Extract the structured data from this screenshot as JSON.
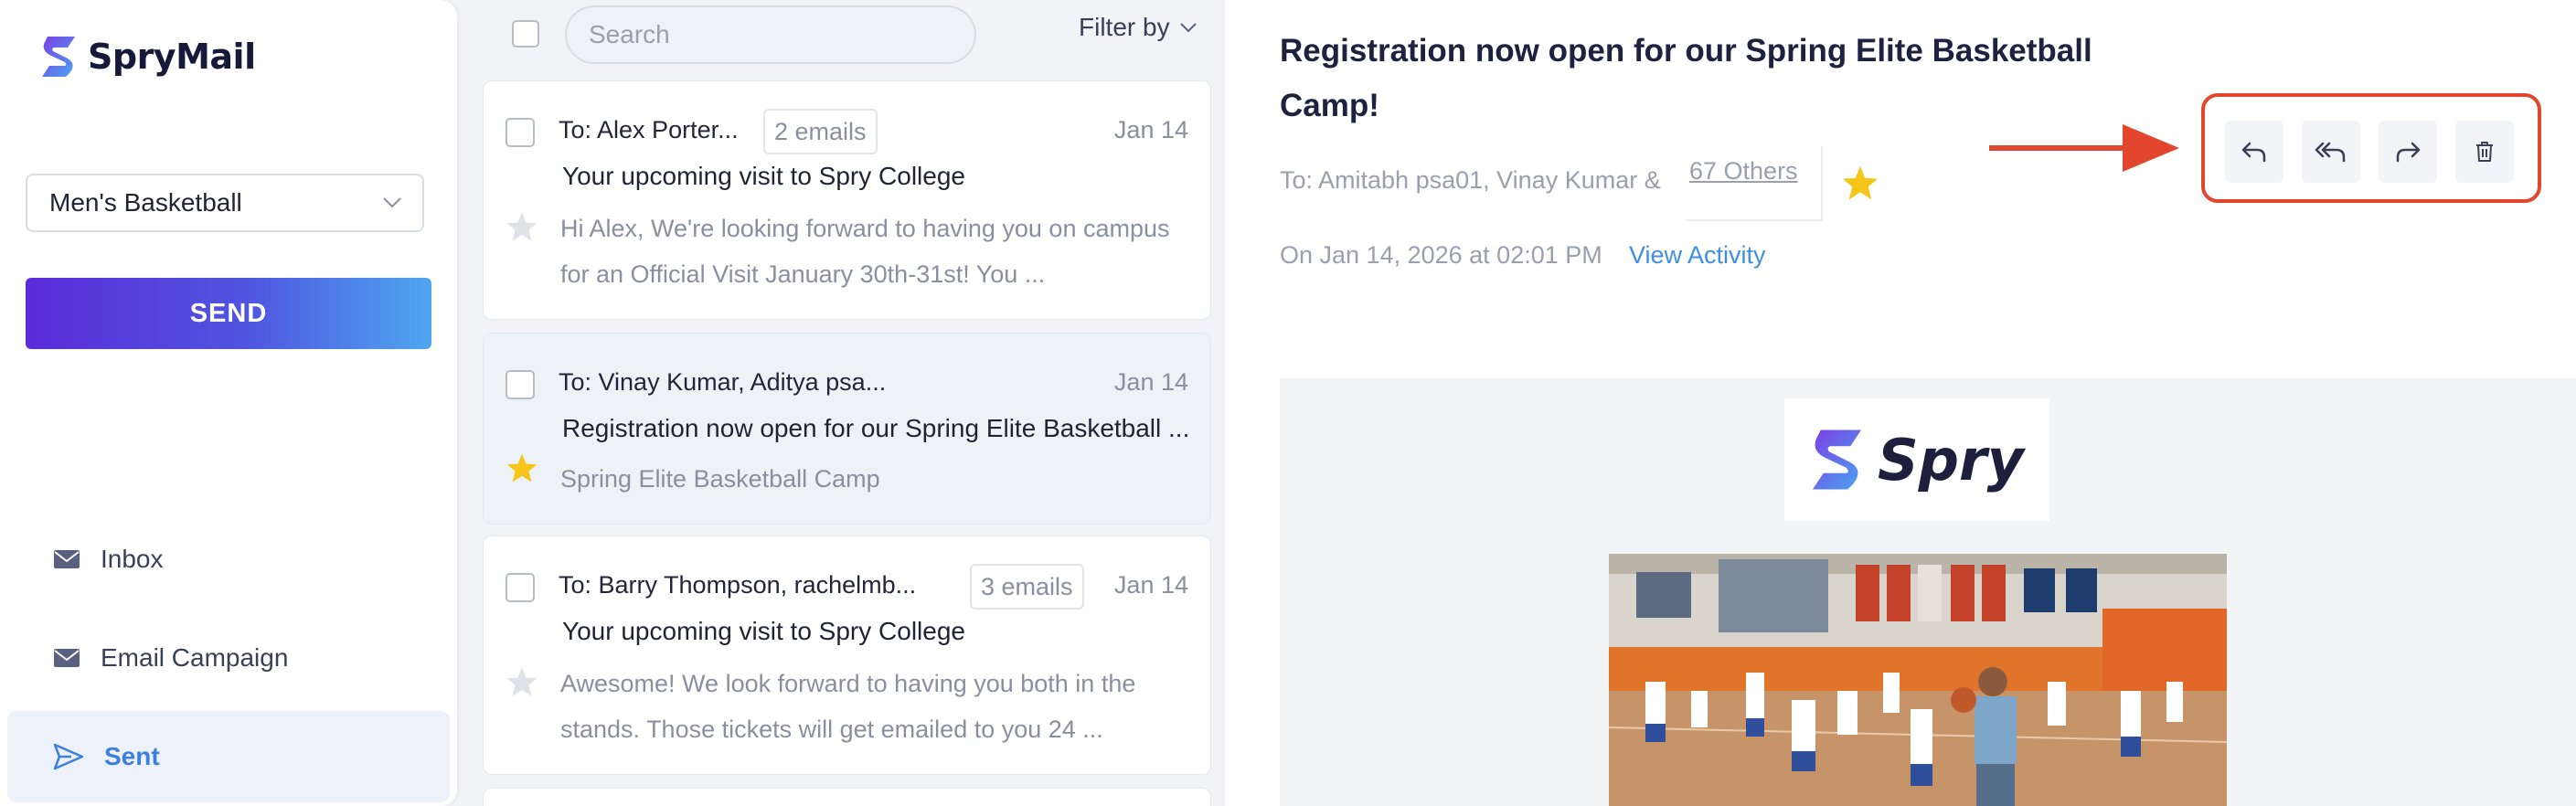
{
  "app": {
    "name": "SpryMail"
  },
  "sidebar": {
    "team_select": {
      "value": "Men's Basketball"
    },
    "send_label": "SEND",
    "nav": [
      {
        "label": "Inbox",
        "icon": "envelope-icon"
      },
      {
        "label": "Email Campaign",
        "icon": "envelope-icon"
      },
      {
        "label": "Sent",
        "icon": "paper-plane-icon",
        "active": true
      }
    ]
  },
  "list": {
    "search_placeholder": "Search",
    "filter_label": "Filter by",
    "emails": [
      {
        "to": "To: Alex Porter...",
        "count": "2 emails",
        "date": "Jan 14",
        "subject": "Your upcoming visit to Spry College",
        "preview": "Hi Alex, We're looking forward to having you on campus for an Official Visit January 30th-31st! You ...",
        "starred": false
      },
      {
        "to": "To: Vinay  Kumar, Aditya psa...",
        "count": "",
        "date": "Jan 14",
        "subject": "Registration now open for our Spring Elite Basketball ...",
        "preview": "Spring Elite Basketball Camp",
        "starred": true,
        "selected": true
      },
      {
        "to": "To: Barry Thompson, rachelmb...",
        "count": "3 emails",
        "date": "Jan 14",
        "subject": "Your upcoming visit to Spry College",
        "preview": "Awesome! We look forward to having you both in the stands. Those tickets will get emailed to you 24 ...",
        "starred": false
      }
    ]
  },
  "reader": {
    "subject": "Registration now open for our Spring Elite Basketball Camp!",
    "recipients": "To: Amitabh psa01, Vinay  Kumar &",
    "others_link": "67 Others",
    "sent_on": "On Jan 14, 2026 at 02:01 PM",
    "view_activity": "View Activity",
    "brand_name": "Spry",
    "actions": [
      "reply-icon",
      "reply-all-icon",
      "forward-icon",
      "trash-icon"
    ],
    "highlight_color": "#e3462e"
  },
  "colors": {
    "accent": "#3e8fe3",
    "star": "#f5c518",
    "send_gradient_start": "#5b2bd9",
    "send_gradient_end": "#4fa6f0"
  }
}
